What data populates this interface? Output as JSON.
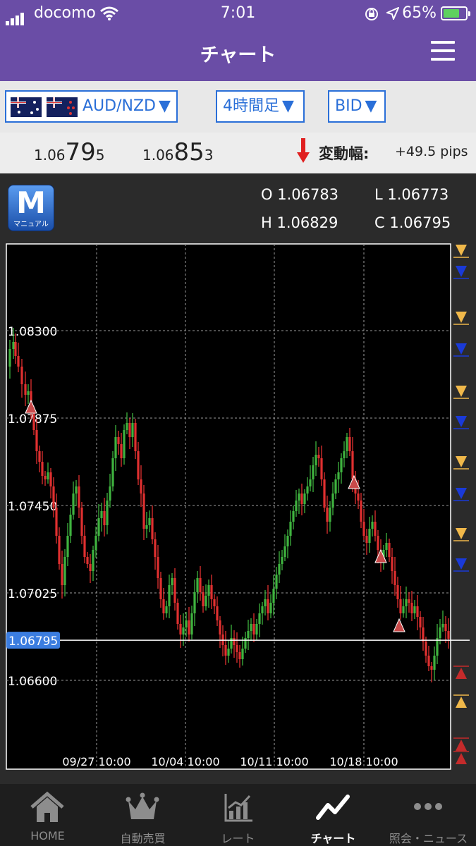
{
  "status": {
    "carrier": "docomo",
    "time": "7:01",
    "battery": "65%"
  },
  "header": {
    "title": "チャート"
  },
  "selector": {
    "pair": "AUD/NZD",
    "timeframe": "4時間足",
    "side": "BID",
    "arrow": "▼"
  },
  "prices": {
    "bid": {
      "prefix": "1.06",
      "big": "79",
      "suffix": "5"
    },
    "ask": {
      "prefix": "1.06",
      "big": "85",
      "suffix": "3"
    },
    "change_label": "変動幅:",
    "change_value": "+49.5 pips"
  },
  "manual": {
    "letter": "M",
    "label": "マニュアル"
  },
  "ohlc": {
    "o": "O 1.06783",
    "h": "H 1.06829",
    "l": "L 1.06773",
    "c": "C 1.06795"
  },
  "chart": {
    "y_ticks": [
      "1.08300",
      "1.07875",
      "1.07450",
      "1.07025",
      "1.06600"
    ],
    "x_ticks": [
      "09/27 10:00",
      "10/04 10:00",
      "10/11 10:00",
      "10/18 10:00"
    ],
    "current_price": "1.06795",
    "colors": {
      "up": "#3fb33f",
      "down": "#e03030",
      "marker": "#c94a4a",
      "grid": "#9a9a9a",
      "order_yellow": "#f0b84a",
      "order_blue": "#1a3ad8",
      "order_red": "#c42b2b"
    }
  },
  "tabs": [
    {
      "label": "HOME",
      "icon": "home-icon"
    },
    {
      "label": "自動売買",
      "icon": "crown-icon"
    },
    {
      "label": "レート",
      "icon": "rate-chart-icon"
    },
    {
      "label": "チャート",
      "icon": "chart-line-icon"
    },
    {
      "label": "照会・ニュース",
      "icon": "more-dots-icon"
    }
  ]
}
